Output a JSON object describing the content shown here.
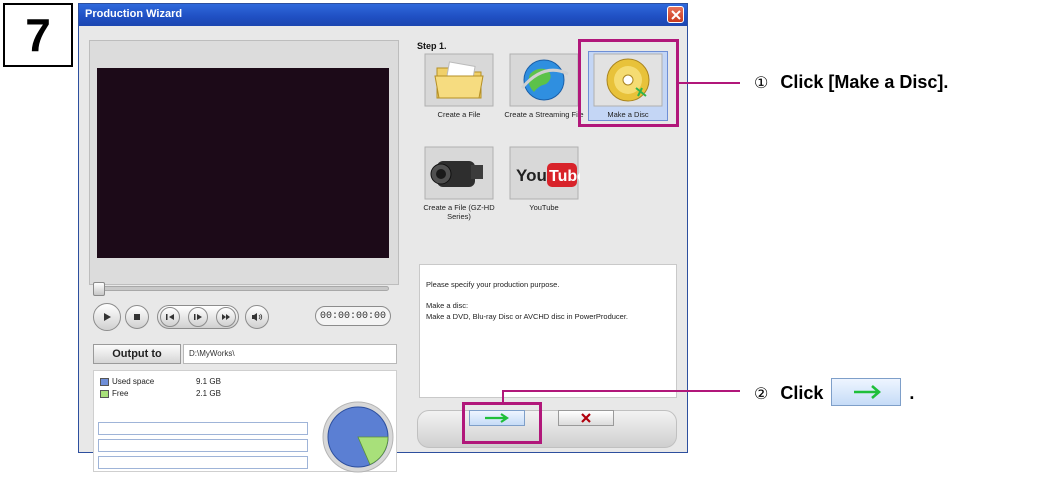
{
  "step_number": "7",
  "window": {
    "title": "Production Wizard"
  },
  "player": {
    "timecode": "00:00:00:00"
  },
  "output": {
    "button_label": "Output to",
    "path": "D:\\MyWorks\\"
  },
  "disk_space": {
    "items": [
      {
        "label": "Used space",
        "value": "9.1  GB",
        "color": "#6f8fd8"
      },
      {
        "label": "Free",
        "value": "2.1  GB",
        "color": "#a8e07a"
      }
    ]
  },
  "wizard": {
    "step_label": "Step 1.",
    "tiles": [
      {
        "caption": "Create a File",
        "icon": "folder-icon"
      },
      {
        "caption": "Create a Streaming File",
        "icon": "globe-icon"
      },
      {
        "caption": "Make a Disc",
        "icon": "disc-icon",
        "selected": true
      },
      {
        "caption": "Create a File (GZ-HD Series)",
        "icon": "camcorder-icon"
      },
      {
        "caption": "YouTube",
        "icon": "youtube-icon"
      }
    ],
    "description": {
      "line1": "Please specify your production purpose.",
      "line2": "Make a disc:",
      "line3": "Make a DVD, Blu-ray Disc or AVCHD disc in PowerProducer."
    }
  },
  "annotations": {
    "a1": {
      "num": "①",
      "text": "Click [Make a Disc]."
    },
    "a2": {
      "num": "②",
      "prefix": "Click",
      "suffix": "."
    }
  },
  "colors": {
    "highlight": "#b1177a",
    "next_arrow": "#1fbf3a",
    "cancel_x": "#b0000c"
  }
}
